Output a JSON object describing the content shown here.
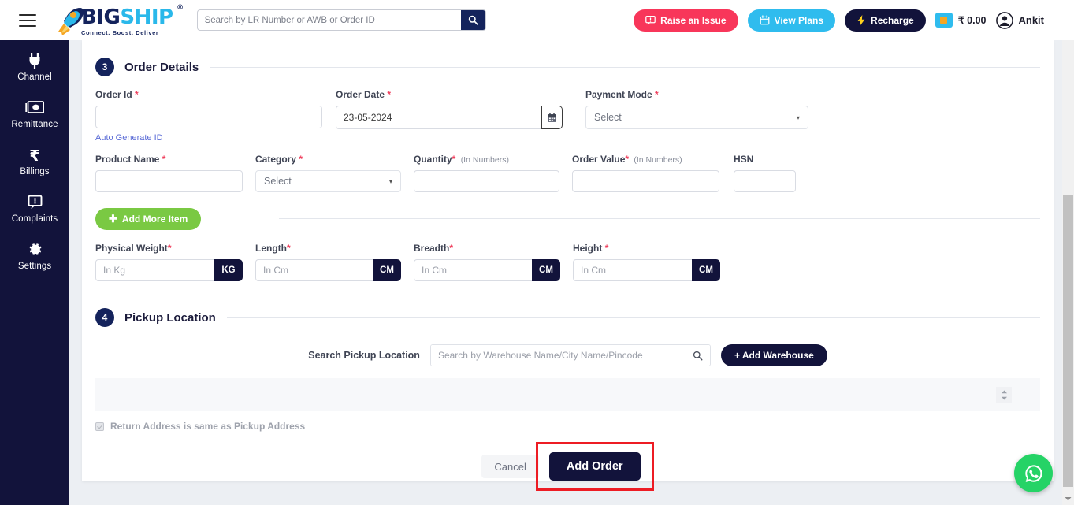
{
  "header": {
    "menu_icon": "hamburger-icon",
    "logo": {
      "brand_main": "BIG",
      "brand_accent": "SHIP",
      "registered": "®",
      "tagline": "Connect. Boost. Deliver"
    },
    "search": {
      "placeholder": "Search by LR Number or AWB or Order ID",
      "value": "",
      "icon": "search-icon"
    },
    "raise_issue": {
      "label": "Raise an Issue",
      "icon": "chat-alert-icon",
      "color": "#f8365a"
    },
    "view_plans": {
      "label": "View Plans",
      "icon": "calendar-icon",
      "color": "#2fbcee"
    },
    "recharge": {
      "label": "Recharge",
      "icon": "lightning-icon",
      "color": "#12133b"
    },
    "wallet": {
      "amount": "₹ 0.00",
      "icon": "wallet-icon"
    },
    "user": {
      "name": "Ankit",
      "icon": "avatar-icon"
    }
  },
  "sidebar": {
    "items": [
      {
        "label": "Channel",
        "icon": "plug-icon"
      },
      {
        "label": "Remittance",
        "icon": "cash-icon"
      },
      {
        "label": "Billings",
        "icon": "rupee-icon"
      },
      {
        "label": "Complaints",
        "icon": "comment-alert-icon"
      },
      {
        "label": "Settings",
        "icon": "gear-icon"
      }
    ]
  },
  "order_details": {
    "step": "3",
    "title": "Order Details",
    "order_id": {
      "label": "Order Id",
      "required": "*",
      "value": "",
      "placeholder": ""
    },
    "auto_generate": "Auto Generate ID",
    "order_date": {
      "label": "Order Date",
      "required": "*",
      "value": "23-05-2024",
      "icon": "calendar-icon"
    },
    "payment_mode": {
      "label": "Payment Mode",
      "required": "*",
      "selected": "Select",
      "caret": "▾"
    },
    "product_name": {
      "label": "Product Name",
      "required": "*",
      "value": "",
      "placeholder": ""
    },
    "category": {
      "label": "Category",
      "required": "*",
      "selected": "Select",
      "caret": "▾"
    },
    "quantity": {
      "label": "Quantity",
      "required": "*",
      "hint": "(In Numbers)",
      "value": "",
      "placeholder": ""
    },
    "order_value": {
      "label": "Order Value",
      "required": "*",
      "hint": "(In Numbers)",
      "value": "",
      "placeholder": ""
    },
    "hsn": {
      "label": "HSN",
      "value": "",
      "placeholder": ""
    },
    "add_more_item": {
      "label": "Add More Item",
      "icon": "plus-icon",
      "color": "#7ac943"
    },
    "physical_weight": {
      "label": "Physical Weight",
      "required": "*",
      "placeholder": "In Kg",
      "unit": "KG",
      "value": ""
    },
    "length": {
      "label": "Length",
      "required": "*",
      "placeholder": "In Cm",
      "unit": "CM",
      "value": ""
    },
    "breadth": {
      "label": "Breadth",
      "required": "*",
      "placeholder": "In Cm",
      "unit": "CM",
      "value": ""
    },
    "height": {
      "label": "Height",
      "required": "*",
      "placeholder": "In Cm",
      "unit": "CM",
      "value": ""
    }
  },
  "pickup_location": {
    "step": "4",
    "title": "Pickup Location",
    "search_label": "Search Pickup Location",
    "search_placeholder": "Search by Warehouse Name/City Name/Pincode",
    "search_value": "",
    "search_icon": "search-icon",
    "add_warehouse": {
      "label": "+ Add Warehouse",
      "color": "#12133b"
    },
    "sort_handle_icon": "sort-updown-icon"
  },
  "footer": {
    "return_address_checkbox": {
      "label": "Return Address is same as Pickup Address",
      "checked": true
    },
    "cancel": "Cancel",
    "add_order": "Add Order",
    "highlight_color": "#ed1c24"
  },
  "floating": {
    "whatsapp_icon": "whatsapp-icon",
    "whatsapp_color": "#25d366"
  },
  "scrollbar": {
    "thumb_color": "#c1c1c1",
    "track_color": "#f1f1f1",
    "arrow_icon": "chevron-down-icon"
  }
}
